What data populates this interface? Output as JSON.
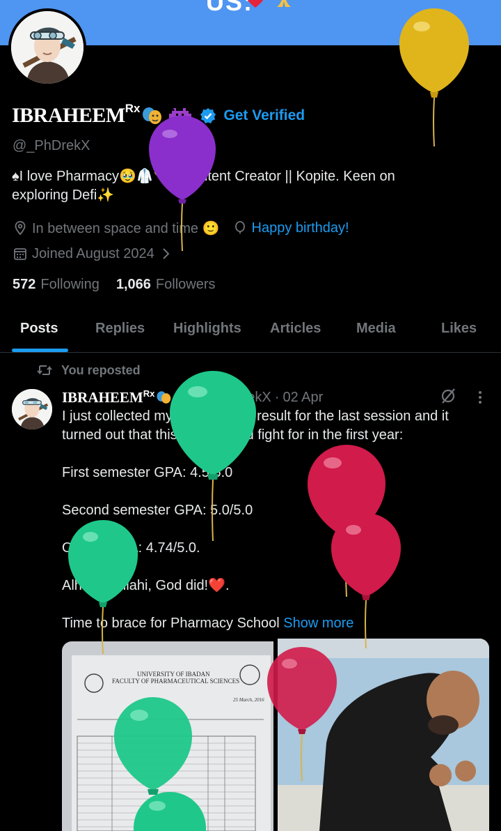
{
  "banner": {
    "text": "US:",
    "emoji": [
      "red-heart",
      "folded-hands"
    ]
  },
  "profile": {
    "display_name": "IBRAHEEM",
    "name_superscript": "Rx",
    "name_emoji": [
      "performing-arts-icon",
      "space-invader-icon"
    ],
    "verified_badge": "verified-badge-icon",
    "get_verified_label": "Get Verified",
    "handle": "@_PhDrekX",
    "bio_line1": "♠I love Pharmacy🥹🥼💊|| Content Creator || Kopite. Keen on",
    "bio_line2": "exploring Defi✨",
    "location": "In between space and time 🙂",
    "birthday": "Happy birthday!",
    "joined": "Joined August 2024",
    "following_count": "572",
    "following_label": "Following",
    "followers_count": "1,066",
    "followers_label": "Followers"
  },
  "tabs": [
    {
      "label": "Posts",
      "active": true
    },
    {
      "label": "Replies",
      "active": false
    },
    {
      "label": "Highlights",
      "active": false
    },
    {
      "label": "Articles",
      "active": false
    },
    {
      "label": "Media",
      "active": false
    },
    {
      "label": "Likes",
      "active": false
    }
  ],
  "post": {
    "repost_label": "You reposted",
    "author_name": "IBRAHEEM",
    "author_superscript": "Rx",
    "author_handle": "@_PhDrekX",
    "separator": "·",
    "date": "02 Apr",
    "text_lines": [
      "I just collected my statement of result for the last session and it turned out that this is all I could fight for in the first year:",
      "First semester GPA: 4.5/5.0",
      "Second semester GPA: 5.0/5.0",
      "Overall GPA: 4.74/5.0.",
      "Alhamdulillahi, God did!❤️.",
      "Time to brace for Pharmacy School"
    ],
    "show_more": "Show more",
    "media": {
      "left_image": {
        "kind": "result-sheet-photo",
        "title_line1": "UNIVERSITY OF IBADAN",
        "title_line2": "FACULTY OF PHARMACEUTICAL SCIENCES",
        "date": "25 March, 2016"
      },
      "right_image": {
        "kind": "celebration-photo"
      }
    }
  },
  "colors": {
    "background": "#000000",
    "accent": "#1d9bf0",
    "banner": "#4f95f2",
    "muted_text": "#71767b"
  }
}
